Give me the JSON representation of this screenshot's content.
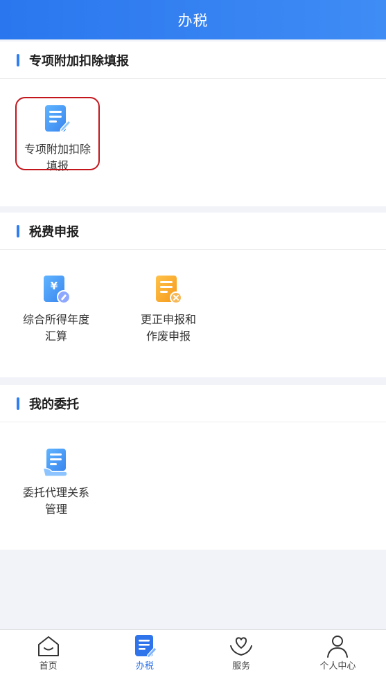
{
  "header": {
    "title": "办税"
  },
  "sections": [
    {
      "title": "专项附加扣除填报",
      "items": [
        {
          "label": "专项附加扣除\n填报",
          "icon": "edit-document-icon",
          "highlighted": true
        }
      ]
    },
    {
      "title": "税费申报",
      "items": [
        {
          "label": "综合所得年度\n汇算",
          "icon": "yuan-document-icon"
        },
        {
          "label": "更正申报和\n作废申报",
          "icon": "document-cancel-icon"
        }
      ]
    },
    {
      "title": "我的委托",
      "items": [
        {
          "label": "委托代理关系\n管理",
          "icon": "document-hand-icon"
        }
      ]
    }
  ],
  "bottom_nav": [
    {
      "label": "首页",
      "icon": "home-icon",
      "active": false
    },
    {
      "label": "办税",
      "icon": "tax-document-icon",
      "active": true
    },
    {
      "label": "服务",
      "icon": "heart-hands-icon",
      "active": false
    },
    {
      "label": "个人中心",
      "icon": "person-icon",
      "active": false
    }
  ],
  "colors": {
    "brand": "#2f7ef2",
    "highlight": "#c3161c",
    "orange": "#f5a623"
  }
}
